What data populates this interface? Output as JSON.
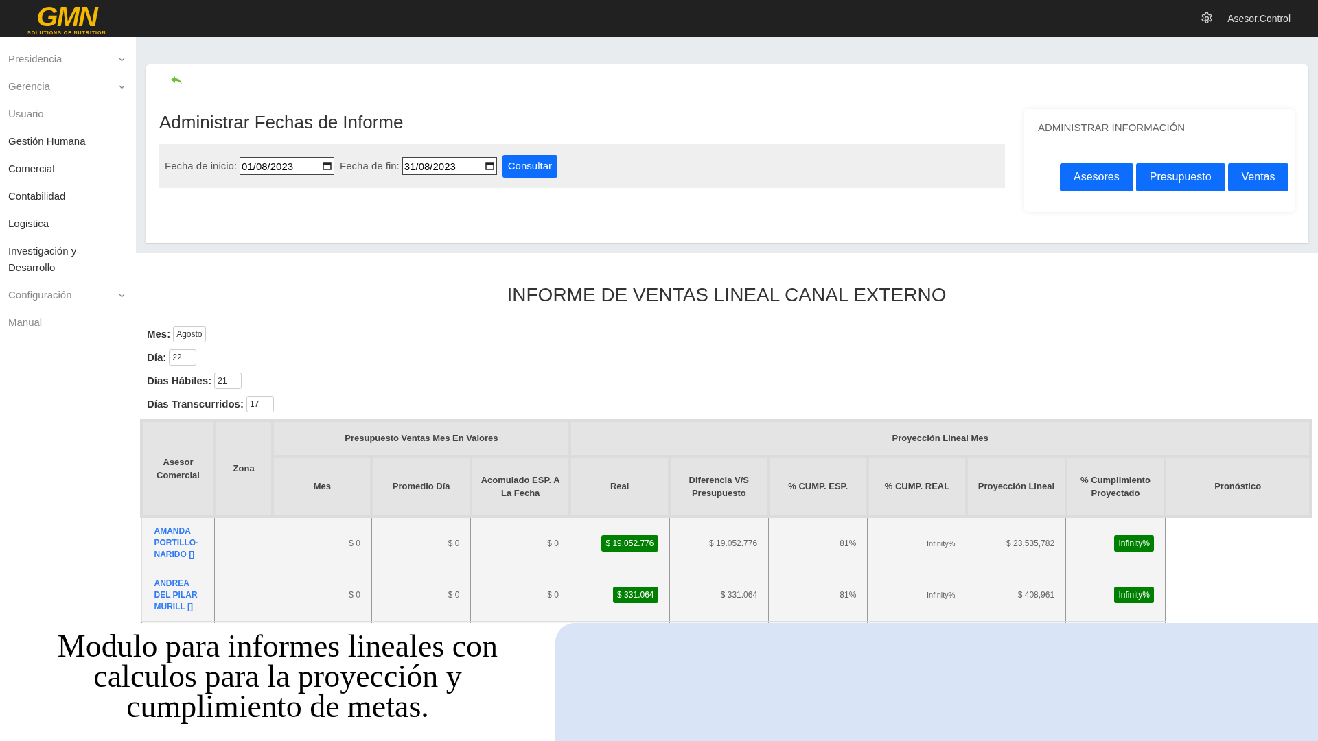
{
  "header": {
    "logo": {
      "mark": "GMN",
      "tagline": "SOLUTIONS OF NUTRITION"
    },
    "user": "Asesor.Control"
  },
  "sidebar": {
    "items": [
      {
        "label": "Presidencia",
        "dimmed": true,
        "expandable": true
      },
      {
        "label": "Gerencia",
        "dimmed": true,
        "expandable": true
      },
      {
        "label": "Usuario",
        "dimmed": true,
        "expandable": false
      },
      {
        "label": "Gestión Humana",
        "dimmed": false,
        "expandable": false
      },
      {
        "label": "Comercial",
        "dimmed": false,
        "expandable": false
      },
      {
        "label": "Contabilidad",
        "dimmed": false,
        "expandable": false
      },
      {
        "label": "Logistica",
        "dimmed": false,
        "expandable": false
      },
      {
        "label": "Investigación y Desarrollo",
        "dimmed": false,
        "expandable": false
      },
      {
        "label": "Configuración",
        "dimmed": true,
        "expandable": true
      },
      {
        "label": "Manual",
        "dimmed": true,
        "expandable": false
      }
    ]
  },
  "dates_panel": {
    "title": "Administrar Fechas de Informe",
    "start_label": "Fecha de inicio:",
    "start_value": "01/08/2023",
    "end_label": "Fecha de fin:",
    "end_value": "31/08/2023",
    "submit": "Consultar"
  },
  "admin_panel": {
    "title": "ADMINISTRAR INFORMACIÓN",
    "buttons": [
      "Asesores",
      "Presupuesto",
      "Ventas"
    ]
  },
  "report": {
    "title": "INFORME DE VENTAS LINEAL CANAL EXTERNO",
    "fields": [
      {
        "label": "Mes:",
        "value": "Agosto"
      },
      {
        "label": "Día:",
        "value": "22"
      },
      {
        "label": "Días Hábiles:",
        "value": "21"
      },
      {
        "label": "Días Transcurridos:",
        "value": "17"
      }
    ],
    "table": {
      "asesor_header": "Asesor Comercial",
      "zona_header": "Zona",
      "pronostico_header": "Pronóstico",
      "groups": [
        {
          "label": "Presupuesto Ventas Mes En Valores",
          "columns": [
            {
              "label": "Mes",
              "kind": "text"
            },
            {
              "label": "Promedio Día",
              "kind": "text"
            },
            {
              "label": "Acomulado ESP. A La Fecha",
              "kind": "text"
            }
          ]
        },
        {
          "label": "Proyección Lineal Mes",
          "columns": [
            {
              "label": "Real",
              "kind": "badge"
            },
            {
              "label": "Diferencia V/S Presupuesto",
              "kind": "text"
            },
            {
              "label": "% CUMP. ESP.",
              "kind": "text"
            },
            {
              "label": "% CUMP. REAL",
              "kind": "small"
            },
            {
              "label": "Proyección Lineal",
              "kind": "text"
            },
            {
              "label": "% Cumplimiento Proyectado",
              "kind": "badge"
            }
          ]
        }
      ],
      "rows": [
        {
          "asesor": "AMANDA PORTILLO-NARIÐO []",
          "cells": [
            "$ 0",
            "$ 0",
            "$ 0",
            "$ 19.052.776",
            "$ 19.052.776",
            "81%",
            "Infinity%",
            "$ 23,535,782",
            "Infinity%"
          ]
        },
        {
          "asesor": "ANDREA DEL PILAR MURILL []",
          "cells": [
            "$ 0",
            "$ 0",
            "$ 0",
            "$ 331.064",
            "$ 331.064",
            "81%",
            "Infinity%",
            "$ 408,961",
            "Infinity%"
          ]
        }
      ]
    }
  },
  "caption": "Modulo para informes lineales con calculos para la proyección y cumplimiento de metas."
}
